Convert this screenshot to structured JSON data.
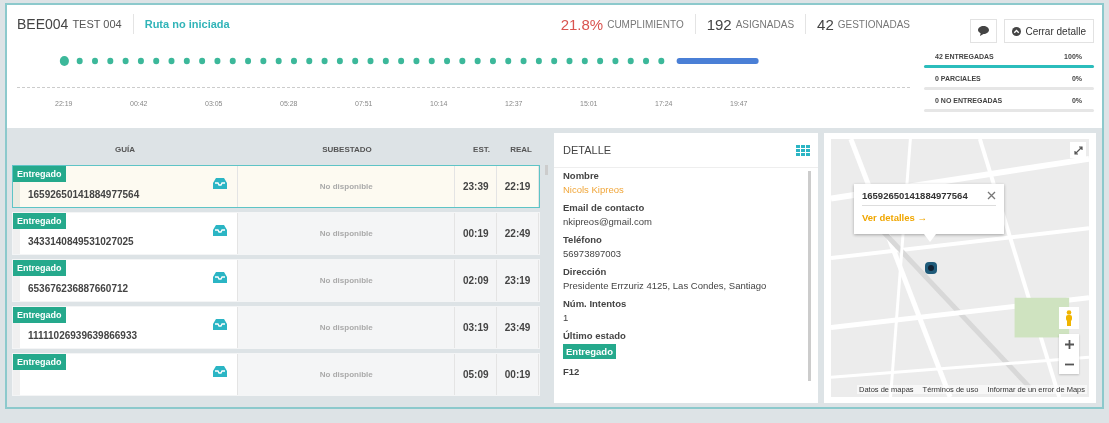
{
  "header": {
    "code": "BEE004",
    "name": "TEST 004",
    "status": "Ruta no iniciada"
  },
  "stats": [
    {
      "value": "21.8%",
      "label": "CUMPLIMIENTO",
      "kind": "alert"
    },
    {
      "value": "192",
      "label": "ASIGNADAS",
      "kind": "normal"
    },
    {
      "value": "42",
      "label": "GESTIONADAS",
      "kind": "normal"
    }
  ],
  "close_button": "Cerrar detalle",
  "timeline": {
    "ticks": [
      "22:19",
      "00:42",
      "03:05",
      "05:28",
      "07:51",
      "10:14",
      "12:37",
      "15:01",
      "17:24",
      "19:47"
    ]
  },
  "summary": [
    {
      "label": "42 ENTREGADAS",
      "percent": "100%",
      "level": 1
    },
    {
      "label": "0 PARCIALES",
      "percent": "0%"
    },
    {
      "label": "0 NO ENTREGADAS",
      "percent": "0%"
    }
  ],
  "table": {
    "columns": [
      "GUÍA",
      "SUBESTADO",
      "EST.",
      "REAL"
    ],
    "rows": [
      {
        "status": "Entregado",
        "guide": "16592650141884977564",
        "substatus": "No disponible",
        "est": "23:39",
        "real": "22:19",
        "selected": true
      },
      {
        "status": "Entregado",
        "guide": "3433140849531027025",
        "substatus": "No disponible",
        "est": "00:19",
        "real": "22:49",
        "selected": false
      },
      {
        "status": "Entregado",
        "guide": "653676236887660712",
        "substatus": "No disponible",
        "est": "02:09",
        "real": "23:19",
        "selected": false
      },
      {
        "status": "Entregado",
        "guide": "11111026939639866933",
        "substatus": "No disponible",
        "est": "03:19",
        "real": "23:49",
        "selected": false
      },
      {
        "status": "Entregado",
        "substatus": "No disponible",
        "est": "05:09",
        "real": "00:19",
        "selected": false
      }
    ]
  },
  "detail": {
    "title": "DETALLE",
    "fields": [
      {
        "label": "Nombre",
        "value": "Nicols Kipreos",
        "kind": "highlight"
      },
      {
        "label": "Email de contacto",
        "value": "nkipreos@gmail.com",
        "kind": "text"
      },
      {
        "label": "Teléfono",
        "value": "56973897003",
        "kind": "text"
      },
      {
        "label": "Dirección",
        "value": "Presidente Errzuriz 4125, Las Condes, Santiago",
        "kind": "text"
      },
      {
        "label": "Núm. Intentos",
        "value": "1",
        "kind": "text"
      },
      {
        "label": "Último estado",
        "value": "Entregado",
        "kind": "badge"
      },
      {
        "label": "F12"
      }
    ]
  },
  "map": {
    "popup": {
      "guide": "16592650141884977564",
      "link": "Ver detalles →"
    },
    "attribution": [
      "Datos de mapas",
      "Términos de uso",
      "Informar de un error de Maps"
    ]
  }
}
